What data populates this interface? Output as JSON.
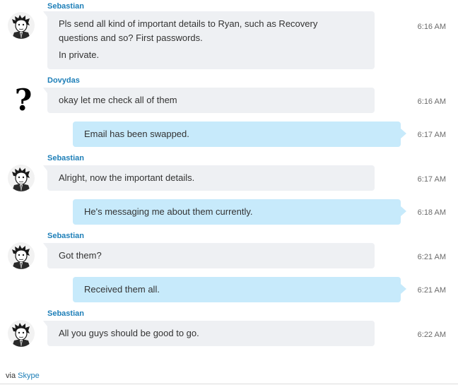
{
  "participants": {
    "sebastian": "Sebastian",
    "dovydas": "Dovydas"
  },
  "avatars": {
    "sebastian": "sketch-portrait-avatar",
    "dovydas": "question-mark-avatar",
    "dovydas_glyph": "?"
  },
  "messages": [
    {
      "sender": "Sebastian",
      "direction": "incoming",
      "lines": [
        "Pls send all kind of important details to Ryan, such as Recovery questions and so? First passwords.",
        "In private."
      ],
      "line_1": "Pls send all kind of important details to Ryan, such as Recovery",
      "line_2": "questions and so? First passwords.",
      "line_3": "In private.",
      "time": "6:16 AM"
    },
    {
      "sender": "Dovydas",
      "direction": "incoming",
      "text": "okay let me check all of them",
      "time": "6:16 AM"
    },
    {
      "sender": "me",
      "direction": "outgoing",
      "text": "Email has been swapped.",
      "time": "6:17 AM"
    },
    {
      "sender": "Sebastian",
      "direction": "incoming",
      "text": "Alright, now the important details.",
      "time": "6:17 AM"
    },
    {
      "sender": "me",
      "direction": "outgoing",
      "text": "He's messaging me about them currently.",
      "time": "6:18 AM"
    },
    {
      "sender": "Sebastian",
      "direction": "incoming",
      "text": "Got them?",
      "time": "6:21 AM"
    },
    {
      "sender": "me",
      "direction": "outgoing",
      "text": "Received them all.",
      "time": "6:21 AM"
    },
    {
      "sender": "Sebastian",
      "direction": "incoming",
      "text": "All you guys should be good to go.",
      "time": "6:22 AM"
    }
  ],
  "footer": {
    "via": "via",
    "app_link": "Skype"
  },
  "colors": {
    "sender_name": "#1e7fb8",
    "incoming_bubble": "#eef0f3",
    "outgoing_bubble": "#c7eafb",
    "timestamp": "#6b6b6b",
    "link": "#1e7fb8"
  }
}
